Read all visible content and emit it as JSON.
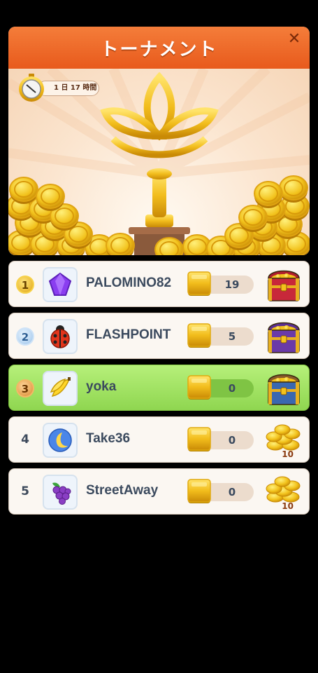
{
  "header": {
    "title": "トーナメント"
  },
  "timer": {
    "text": "1 日 17 時間"
  },
  "colors": {
    "header": "#e85a1c",
    "me_row": "#9ee060",
    "gold": "#f0c020"
  },
  "players": [
    {
      "rank": "1",
      "name": "PALOMINO82",
      "score": "19",
      "avatar": "gem-icon",
      "reward": "red-treasure-chest-icon",
      "reward_count": ""
    },
    {
      "rank": "2",
      "name": "FLASHPOINT",
      "score": "5",
      "avatar": "ladybug-icon",
      "reward": "purple-treasure-chest-icon",
      "reward_count": ""
    },
    {
      "rank": "3",
      "name": "yoka",
      "score": "0",
      "avatar": "banana-icon",
      "reward": "blue-treasure-chest-icon",
      "reward_count": ""
    },
    {
      "rank": "4",
      "name": "Take36",
      "score": "0",
      "avatar": "moon-icon",
      "reward": "coin-pile-icon",
      "reward_count": "10"
    },
    {
      "rank": "5",
      "name": "StreetAway",
      "score": "0",
      "avatar": "grapes-icon",
      "reward": "coin-pile-icon",
      "reward_count": "10"
    }
  ]
}
